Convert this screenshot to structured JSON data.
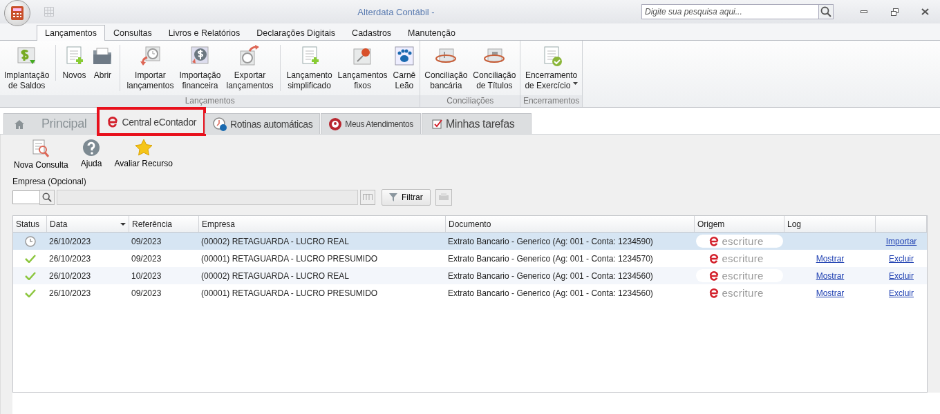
{
  "window": {
    "title": "Alterdata Contábil -",
    "search": {
      "placeholder": "Digite sua pesquisa aqui..."
    }
  },
  "ribbon_tabs": [
    {
      "label": "Lançamentos",
      "selected": true
    },
    {
      "label": "Consultas",
      "selected": false
    },
    {
      "label": "Livros e Relatórios",
      "selected": false
    },
    {
      "label": "Declarações Digitais",
      "selected": false
    },
    {
      "label": "Cadastros",
      "selected": false
    },
    {
      "label": "Manutenção",
      "selected": false
    }
  ],
  "ribbon_groups": [
    {
      "label": "Lançamentos",
      "buttons": [
        {
          "label": "Implantação\nde Saldos",
          "divider_before": false
        },
        {
          "label": "Novos",
          "divider_before": true
        },
        {
          "label": "Abrir",
          "divider_before": false
        },
        {
          "label": "Importar\nlançamentos",
          "divider_before": true
        },
        {
          "label": "Importação\nfinanceira",
          "divider_before": false
        },
        {
          "label": "Exportar\nlançamentos",
          "divider_before": false
        },
        {
          "label": "Lançamento\nsimplificado",
          "divider_before": true
        },
        {
          "label": "Lançamentos\nfixos",
          "divider_before": false
        },
        {
          "label": "Carnê\nLeão",
          "divider_before": false
        }
      ]
    },
    {
      "label": "Conciliações",
      "buttons": [
        {
          "label": "Conciliação\nbancária",
          "divider_before": false
        },
        {
          "label": "Conciliação\nde Títulos",
          "divider_before": false
        }
      ]
    },
    {
      "label": "Encerramentos",
      "buttons": [
        {
          "label": "Encerramento\nde Exercício",
          "divider_before": false,
          "dropdown": true
        }
      ]
    }
  ],
  "doc_tabs": [
    {
      "label": "Principal",
      "selected": false,
      "highlighted": false
    },
    {
      "label": "Central eContador",
      "selected": true,
      "highlighted": true
    },
    {
      "label": "Rotinas automáticas",
      "selected": false,
      "highlighted": false
    },
    {
      "label": "Meus Atendimentos",
      "selected": false,
      "highlighted": false
    },
    {
      "label": "Minhas tarefas",
      "selected": false,
      "highlighted": false
    }
  ],
  "toolbar": [
    "Nova Consulta",
    "Ajuda",
    "Avaliar Recurso"
  ],
  "filter": {
    "label": "Empresa (Opcional)",
    "button": "Filtrar"
  },
  "table": {
    "columns": [
      "Status",
      "Data",
      "Referência",
      "Empresa",
      "Documento",
      "Origem",
      "Log"
    ],
    "rows": [
      {
        "kind": "pending",
        "selected": true,
        "data": "26/10/2023",
        "referencia": "09/2023",
        "empresa": "(00002) RETAGUARDA - LUCRO REAL",
        "documento": "Extrato Bancario - Generico (Ag: 001 - Conta: 1234590)",
        "origem": "escriture",
        "action": "Importar"
      },
      {
        "kind": "done",
        "selected": false,
        "data": "26/10/2023",
        "referencia": "09/2023",
        "empresa": "(00001) RETAGUARDA - LUCRO PRESUMIDO",
        "documento": "Extrato Bancario - Generico (Ag: 001 - Conta: 1234570)",
        "origem": "escriture",
        "log": "Mostrar",
        "action": "Excluir"
      },
      {
        "kind": "done",
        "selected": false,
        "data": "26/10/2023",
        "referencia": "10/2023",
        "empresa": "(00002) RETAGUARDA - LUCRO REAL",
        "documento": "Extrato Bancario - Generico (Ag: 001 - Conta: 1234560)",
        "origem": "escriture",
        "log": "Mostrar",
        "action": "Excluir"
      },
      {
        "kind": "done",
        "selected": false,
        "data": "26/10/2023",
        "referencia": "09/2023",
        "empresa": "(00001) RETAGUARDA - LUCRO PRESUMIDO",
        "documento": "Extrato Bancario - Generico (Ag: 001 - Conta: 1234560)",
        "origem": "escriture",
        "log": "Mostrar",
        "action": "Excluir"
      }
    ]
  }
}
